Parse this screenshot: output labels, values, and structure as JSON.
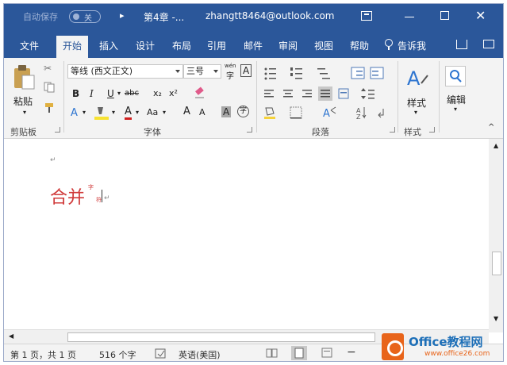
{
  "titlebar": {
    "autosave_label": "自动保存",
    "autosave_state": "关",
    "doc_title": "第4章 -...",
    "account": "zhangtt8464@outlook.com"
  },
  "tabs": [
    "文件",
    "开始",
    "插入",
    "设计",
    "布局",
    "引用",
    "邮件",
    "审阅",
    "视图",
    "帮助"
  ],
  "active_tab": "开始",
  "tell_me": "告诉我",
  "ribbon": {
    "clipboard": {
      "paste_label": "粘贴",
      "group_label": "剪贴板"
    },
    "font": {
      "font_name": "等线 (西文正文)",
      "font_size": "三号",
      "phonetic_label": "wén",
      "bold": "B",
      "italic": "I",
      "underline": "U",
      "strike": "abc",
      "subscript": "x₂",
      "superscript": "x²",
      "grow": "A",
      "shrink": "A",
      "change_case": "Aa",
      "char_border": "A",
      "char_shading": "A",
      "enclose": "字",
      "group_label": "字体"
    },
    "paragraph": {
      "group_label": "段落"
    },
    "styles": {
      "label": "样式",
      "group_label": "样式"
    },
    "editing": {
      "label": "编辑"
    }
  },
  "document": {
    "text": "合并",
    "ruby_top": "字",
    "ruby_bottom": "符"
  },
  "status": {
    "page": "第 1 页，共 1 页",
    "words": "516 个字",
    "language": "英语(美国)"
  },
  "watermark": {
    "title": "Office教程网",
    "url": "www.office26.com"
  },
  "colors": {
    "title_bar": "#2b579a",
    "ribbon_bg": "#f3f3f3",
    "doc_text": "#d03a3a"
  }
}
